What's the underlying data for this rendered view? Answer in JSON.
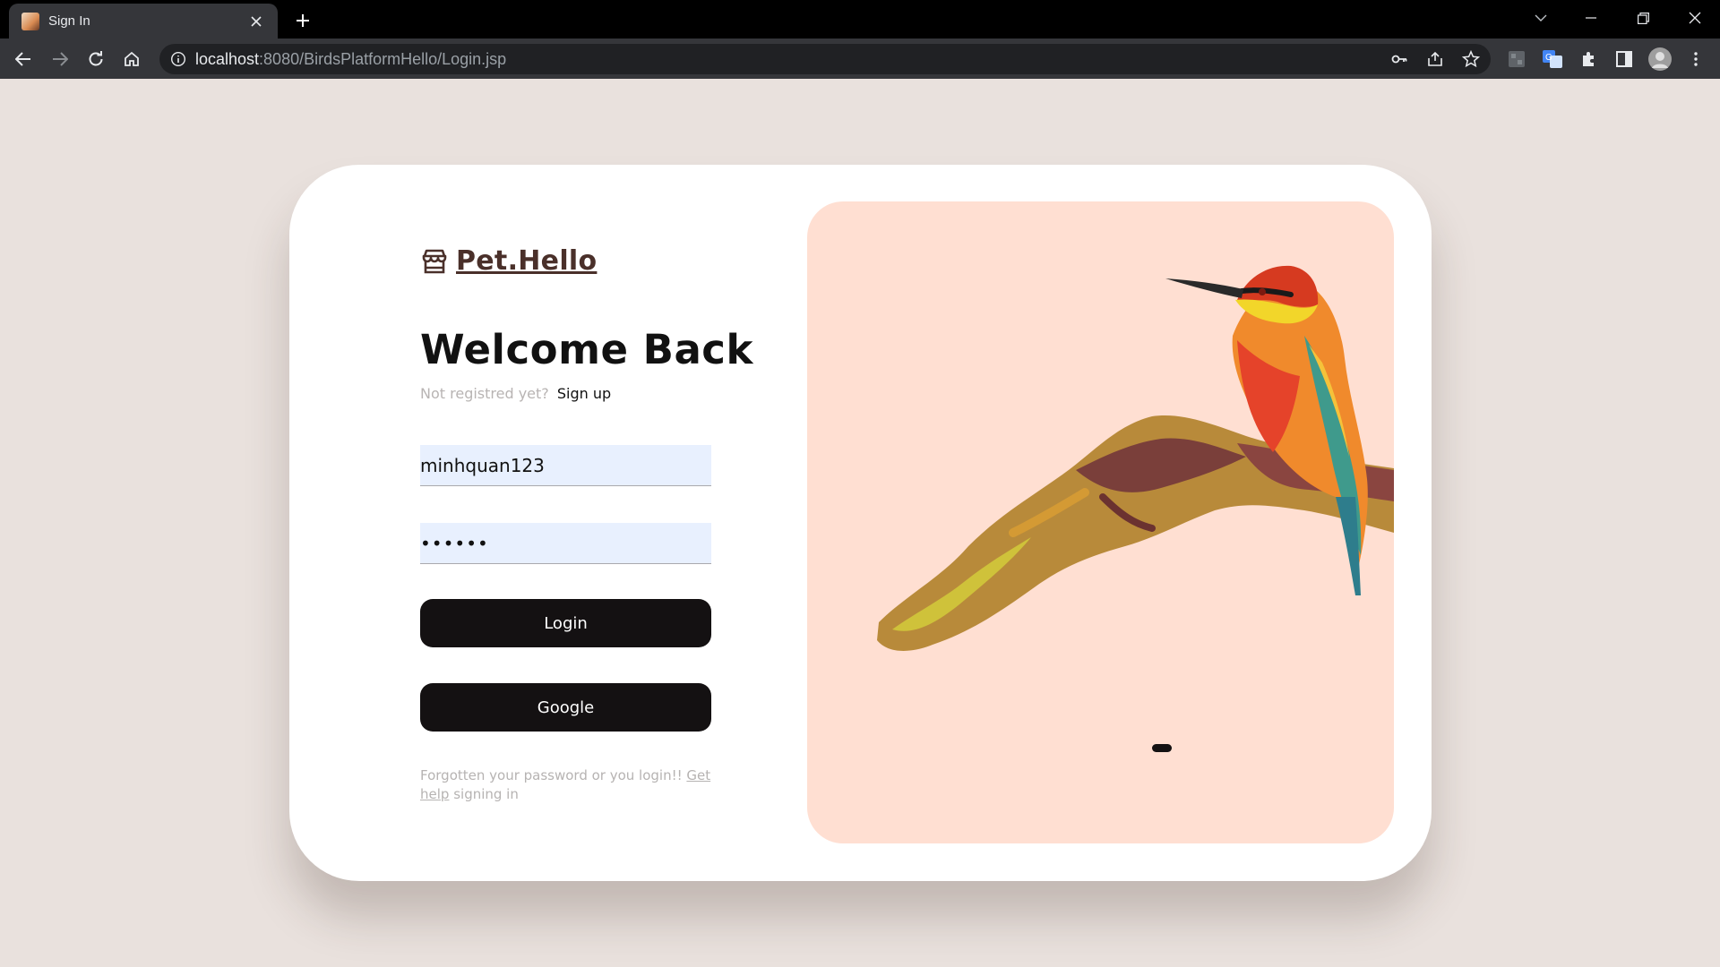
{
  "browser": {
    "tab_title": "Sign In",
    "url_host": "localhost",
    "url_path": ":8080/BirdsPlatformHello/Login.jsp"
  },
  "brand": {
    "name": "Pet.Hello"
  },
  "login": {
    "heading": "Welcome Back",
    "not_registered": "Not registred yet?",
    "signup_link": "Sign up",
    "username_value": "minhquan123",
    "password_value": "••••••",
    "login_button": "Login",
    "google_button": "Google",
    "help_prefix": "Forgotten your password or you login!! ",
    "help_link_1": "Get",
    "help_link_2": "help",
    "help_suffix": " signing in"
  },
  "carousel": {
    "active_index": 1,
    "count": 1
  },
  "colors": {
    "page_bg": "#e9e1dd",
    "card_bg": "#ffffff",
    "hero_bg": "#ffdfd2",
    "button_bg": "#141112",
    "brand": "#4a302a",
    "input_bg": "#e8f0fe"
  }
}
